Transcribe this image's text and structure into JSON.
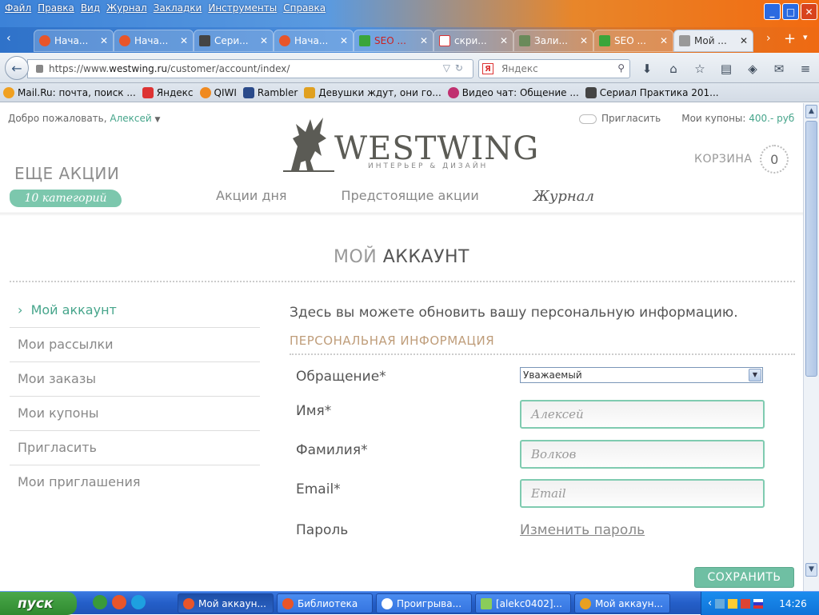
{
  "menu": [
    "Файл",
    "Правка",
    "Вид",
    "Журнал",
    "Закладки",
    "Инструменты",
    "Справка"
  ],
  "tabs": [
    {
      "title": "Нача...",
      "icon_color": "#e8552a"
    },
    {
      "title": "Нача...",
      "icon_color": "#e8552a"
    },
    {
      "title": "Сери...",
      "icon_color": "#444444"
    },
    {
      "title": "Нача...",
      "icon_color": "#e8552a"
    },
    {
      "title": "SEO ...",
      "icon_color": "#3aa53a"
    },
    {
      "title": "скри...",
      "icon_color": "#d33333"
    },
    {
      "title": "Зали...",
      "icon_color": "#6a8a5a"
    },
    {
      "title": "SEO ...",
      "icon_color": "#3aa53a"
    },
    {
      "title": "Мой ...",
      "icon_color": "#999999",
      "active": true
    }
  ],
  "url": {
    "prefix": "https://www.",
    "domain": "westwing.ru",
    "path": "/customer/account/index/"
  },
  "search": {
    "engine": "Я",
    "placeholder": "Яндекс"
  },
  "bookmarks": [
    {
      "label": "Mail.Ru: почта, поиск ...",
      "color": "#f0a020"
    },
    {
      "label": "Яндекс",
      "color": "#d33333"
    },
    {
      "label": "QIWI",
      "color": "#f08a20"
    },
    {
      "label": "Rambler",
      "color": "#2a4a8a"
    },
    {
      "label": "Девушки ждут, они го...",
      "color": "#e0a020"
    },
    {
      "label": "Видео чат: Общение ...",
      "color": "#c03070"
    },
    {
      "label": "Сериал Практика 201...",
      "color": "#444444"
    }
  ],
  "site": {
    "welcome_prefix": "Добро пожаловать, ",
    "user": "Алексей",
    "invite": "Пригласить",
    "coupons_label": "Мои купоны: ",
    "coupons_value": "400.- руб",
    "logo_word": "WESTWING",
    "logo_sub": "ИНТЕРЬЕР & ДИЗАЙН",
    "cart_label": "КОРЗИНА",
    "cart_count": "0",
    "more_promos": "ЕЩЕ АКЦИИ",
    "more_categories": "10 категорий",
    "nav": [
      "Акции дня",
      "Предстоящие акции"
    ],
    "nav_journal": "Журнал",
    "title_light": "МОЙ ",
    "title_bold": "АККАУНТ"
  },
  "sidebar": [
    "Мой аккаунт",
    "Мои рассылки",
    "Мои заказы",
    "Мои купоны",
    "Пригласить",
    "Мои приглашения"
  ],
  "form": {
    "intro": "Здесь вы можете обновить вашу персональную информацию.",
    "section": "ПЕРСОНАЛЬНАЯ ИНФОРМАЦИЯ",
    "salutation_label": "Обращение*",
    "salutation_value": "Уважаемый",
    "first_name_label": "Имя*",
    "first_name_value": "Алексей",
    "last_name_label": "Фамилия*",
    "last_name_value": "Волков",
    "email_label": "Email*",
    "email_placeholder": "Email",
    "password_label": "Пароль",
    "change_password": "Изменить пароль",
    "save": "СОХРАНИТЬ"
  },
  "taskbar": {
    "start": "пуск",
    "tasks": [
      {
        "label": "Мой аккаун...",
        "color": "#e8552a",
        "active": true
      },
      {
        "label": "Библиотека",
        "color": "#e8552a"
      },
      {
        "label": "Проигрыва...",
        "color": "#ffffff"
      },
      {
        "label": "[alekc0402]...",
        "color": "#8acc5a"
      },
      {
        "label": "Мой аккаун...",
        "color": "#e8a020"
      }
    ],
    "time": "14:26"
  }
}
